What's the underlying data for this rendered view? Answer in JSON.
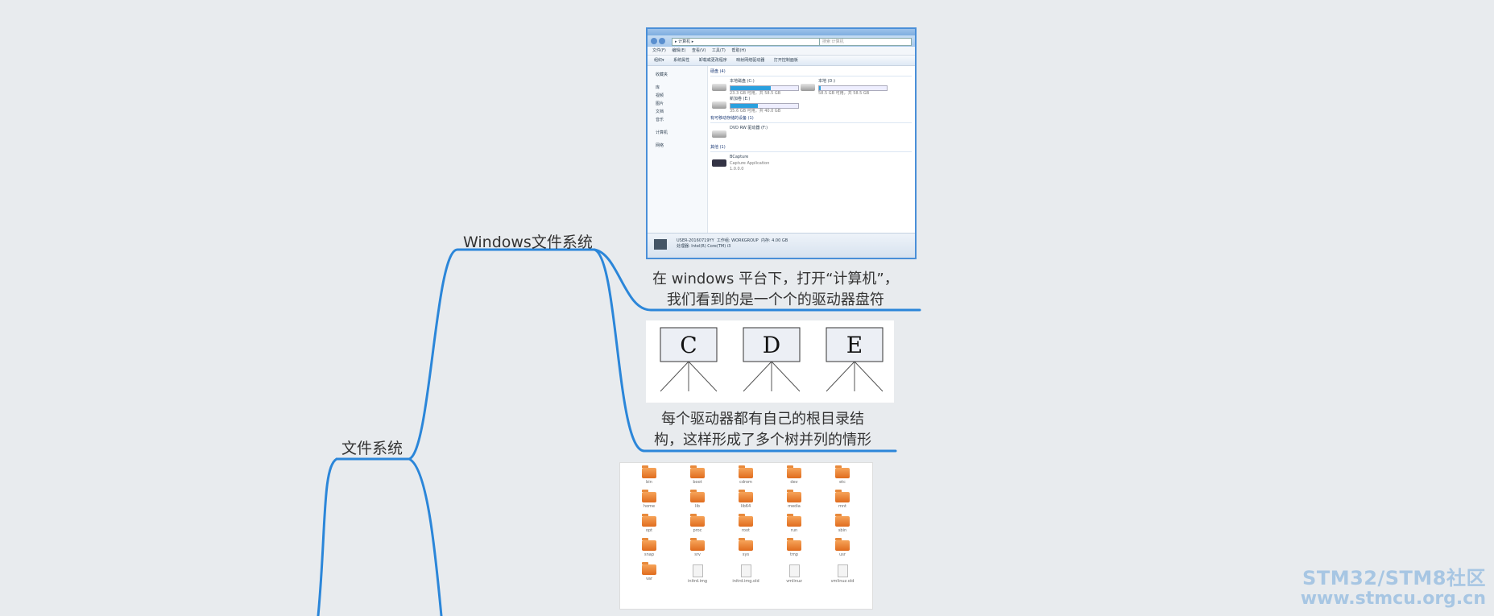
{
  "mindmap": {
    "root_label": "文件系统",
    "branch_label": "Windows文件系统",
    "note1_line1": "在 windows 平台下，打开“计算机”，",
    "note1_line2": "我们看到的是一个个的驱动器盘符",
    "note2_line1": "每个驱动器都有自己的根目录结",
    "note2_line2": "构，这样形成了多个树并列的情形",
    "drive_letters": [
      "C",
      "D",
      "E"
    ],
    "line_color": "#2b86d9"
  },
  "explorer": {
    "address": "▸ 计算机 ▸",
    "search_placeholder": "搜索 计算机",
    "menu": "文件(F) 编辑(E) 查看(V) 工具(T) 帮助(H)",
    "toolbar": "组织▾ 系统属性 卸载或更改程序 映射网络驱动器 打开控制面板",
    "sidebar": [
      "收藏夹",
      "库",
      "视频",
      "图片",
      "文档",
      "音乐",
      "计算机",
      "网络"
    ],
    "section_disks": "硬盘 (4)",
    "drives": [
      {
        "name": "本地磁盘 (C:)",
        "size": "23.3 GB 可用，共 58.5 GB",
        "used": 0.6
      },
      {
        "name": "本地 (D:)",
        "size": "58.5 GB 可用，共 58.5 GB",
        "used": 0.02
      },
      {
        "name": "新加卷 (E:)",
        "size": "35.6 GB 可用，共 40.0 GB",
        "used": 0.4
      }
    ],
    "section_removable": "有可移动存储的设备 (1)",
    "dvd": "DVD RW 驱动器 (F:)",
    "section_other": "其他 (1)",
    "app_name": "BCapture",
    "app_desc": "Capture Application",
    "app_ver": "1.0.0.0",
    "status_name": "USER-20160719YY",
    "status_group": "工作组: WORKGROUP",
    "status_mem": "内存: 4.00 GB",
    "status_cpu": "处理器: Intel(R) Core(TM) i3"
  },
  "folder_grid": {
    "items": [
      {
        "name": "bin",
        "kind": "folder"
      },
      {
        "name": "boot",
        "kind": "folder"
      },
      {
        "name": "cdrom",
        "kind": "folder"
      },
      {
        "name": "dev",
        "kind": "folder"
      },
      {
        "name": "etc",
        "kind": "folder"
      },
      {
        "name": "home",
        "kind": "folder"
      },
      {
        "name": "lib",
        "kind": "folder"
      },
      {
        "name": "lib64",
        "kind": "folder"
      },
      {
        "name": "media",
        "kind": "folder"
      },
      {
        "name": "mnt",
        "kind": "folder"
      },
      {
        "name": "opt",
        "kind": "folder"
      },
      {
        "name": "proc",
        "kind": "folder"
      },
      {
        "name": "root",
        "kind": "folder"
      },
      {
        "name": "run",
        "kind": "folder"
      },
      {
        "name": "sbin",
        "kind": "folder"
      },
      {
        "name": "snap",
        "kind": "folder"
      },
      {
        "name": "srv",
        "kind": "folder"
      },
      {
        "name": "sys",
        "kind": "folder"
      },
      {
        "name": "tmp",
        "kind": "folder"
      },
      {
        "name": "usr",
        "kind": "folder"
      },
      {
        "name": "var",
        "kind": "folder"
      },
      {
        "name": "initrd.img",
        "kind": "file"
      },
      {
        "name": "initrd.img.old",
        "kind": "file"
      },
      {
        "name": "vmlinuz",
        "kind": "file"
      },
      {
        "name": "vmlinuz.old",
        "kind": "file"
      }
    ]
  },
  "watermark": {
    "line1": "STM32/STM8社区",
    "line2": "www.stmcu.org.cn"
  }
}
